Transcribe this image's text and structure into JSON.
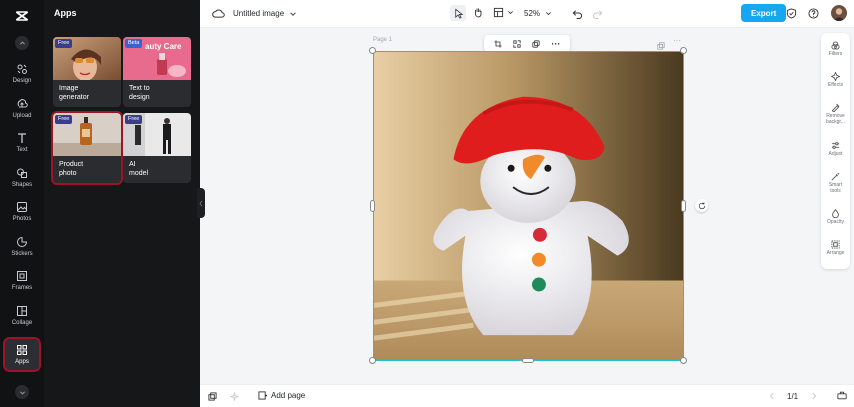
{
  "rail": {
    "items": [
      {
        "label": "Design",
        "icon": "design-icon"
      },
      {
        "label": "Upload",
        "icon": "upload-icon"
      },
      {
        "label": "Text",
        "icon": "text-icon"
      },
      {
        "label": "Shapes",
        "icon": "shapes-icon"
      },
      {
        "label": "Photos",
        "icon": "photos-icon"
      },
      {
        "label": "Stickers",
        "icon": "stickers-icon"
      },
      {
        "label": "Frames",
        "icon": "frames-icon"
      },
      {
        "label": "Collage",
        "icon": "collage-icon"
      },
      {
        "label": "Apps",
        "icon": "apps-icon"
      }
    ]
  },
  "panel": {
    "title": "Apps",
    "cards": [
      {
        "label": "Image\ngenerator",
        "badge": "Free"
      },
      {
        "label": "Text to\ndesign",
        "badge": "Beta",
        "thumb_text": "auty Care"
      },
      {
        "label": "Product\nphoto",
        "badge": "Free"
      },
      {
        "label": "AI\nmodel",
        "badge": "Free"
      }
    ]
  },
  "topbar": {
    "doc_title": "Untitled image",
    "zoom": "52%",
    "export_label": "Export"
  },
  "canvas": {
    "page_label": "Page 1"
  },
  "right_tools": [
    {
      "label": "Filters",
      "icon": "filters-icon"
    },
    {
      "label": "Effects",
      "icon": "effects-icon"
    },
    {
      "label": "Remove backgr...",
      "icon": "remove-background-icon"
    },
    {
      "label": "Adjust",
      "icon": "adjust-icon"
    },
    {
      "label": "Smart tools",
      "icon": "smart-tools-icon"
    },
    {
      "label": "Opacity",
      "icon": "opacity-icon"
    },
    {
      "label": "Arrange",
      "icon": "arrange-icon"
    }
  ],
  "bottombar": {
    "add_page_label": "Add page",
    "page_count": "1/1"
  },
  "colors": {
    "accent": "#17a7f1",
    "selection": "#20c0d0",
    "highlight": "#9c1426"
  }
}
